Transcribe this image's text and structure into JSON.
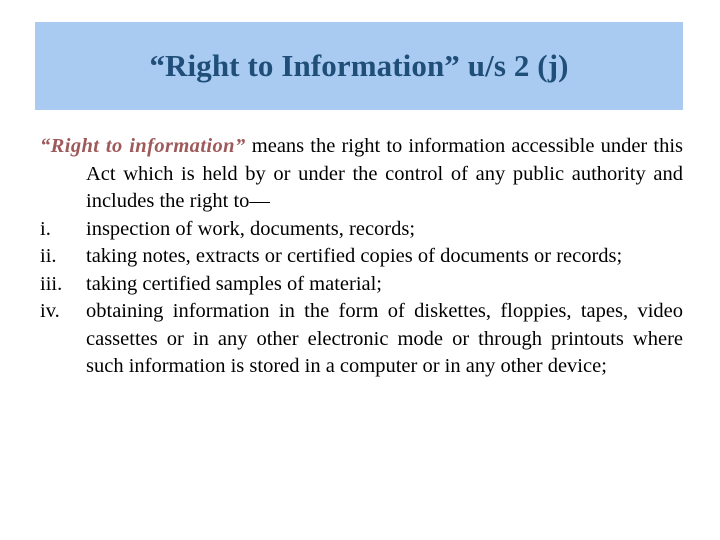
{
  "slide": {
    "title": "“Right to Information” u/s 2 (j)",
    "title_band_color": "#a9cbf1",
    "title_color": "#1f4e79",
    "background_color": "#ffffff",
    "emphasis_color": "#9e5a5a",
    "body_color": "#000000"
  },
  "definition": {
    "term": "“Right to information”",
    "text": " means the right to information accessible under this Act which is held by or under the control of any public authority and includes the right to—"
  },
  "items": [
    {
      "marker": "i.",
      "text": "inspection of work, documents, records;"
    },
    {
      "marker": "ii.",
      "text": "taking notes, extracts or certified copies of documents or records;"
    },
    {
      "marker": "iii.",
      "text": "taking certified samples of material;"
    },
    {
      "marker": "iv.",
      "text": "obtaining information in the form of diskettes, floppies, tapes, video cassettes or in any other electronic mode or through printouts where such information is stored in a computer or in any other device;"
    }
  ]
}
